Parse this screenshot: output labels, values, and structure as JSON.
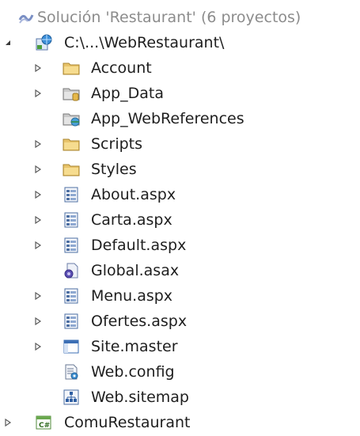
{
  "solution": {
    "label": "Solución 'Restaurant' (6 proyectos)",
    "icon": "solution-icon"
  },
  "project": {
    "label": "C:\\...\\WebRestaurant\\",
    "icon": "web-project-icon",
    "expanded": true
  },
  "items": [
    {
      "label": "Account",
      "icon": "folder-icon",
      "expandable": true
    },
    {
      "label": "App_Data",
      "icon": "app-data-folder-icon",
      "expandable": true
    },
    {
      "label": "App_WebReferences",
      "icon": "web-references-folder-icon",
      "expandable": false
    },
    {
      "label": "Scripts",
      "icon": "folder-icon",
      "expandable": true
    },
    {
      "label": "Styles",
      "icon": "folder-icon",
      "expandable": true
    },
    {
      "label": "About.aspx",
      "icon": "aspx-file-icon",
      "expandable": true
    },
    {
      "label": "Carta.aspx",
      "icon": "aspx-file-icon",
      "expandable": true
    },
    {
      "label": "Default.aspx",
      "icon": "aspx-file-icon",
      "expandable": true
    },
    {
      "label": "Global.asax",
      "icon": "asax-file-icon",
      "expandable": false
    },
    {
      "label": "Menu.aspx",
      "icon": "aspx-file-icon",
      "expandable": true
    },
    {
      "label": "Ofertes.aspx",
      "icon": "aspx-file-icon",
      "expandable": true
    },
    {
      "label": "Site.master",
      "icon": "master-file-icon",
      "expandable": true
    },
    {
      "label": "Web.config",
      "icon": "config-file-icon",
      "expandable": false
    },
    {
      "label": "Web.sitemap",
      "icon": "sitemap-file-icon",
      "expandable": false
    }
  ],
  "next_project": {
    "label": "ComuRestaurant",
    "icon": "csharp-project-icon",
    "expandable": true
  }
}
